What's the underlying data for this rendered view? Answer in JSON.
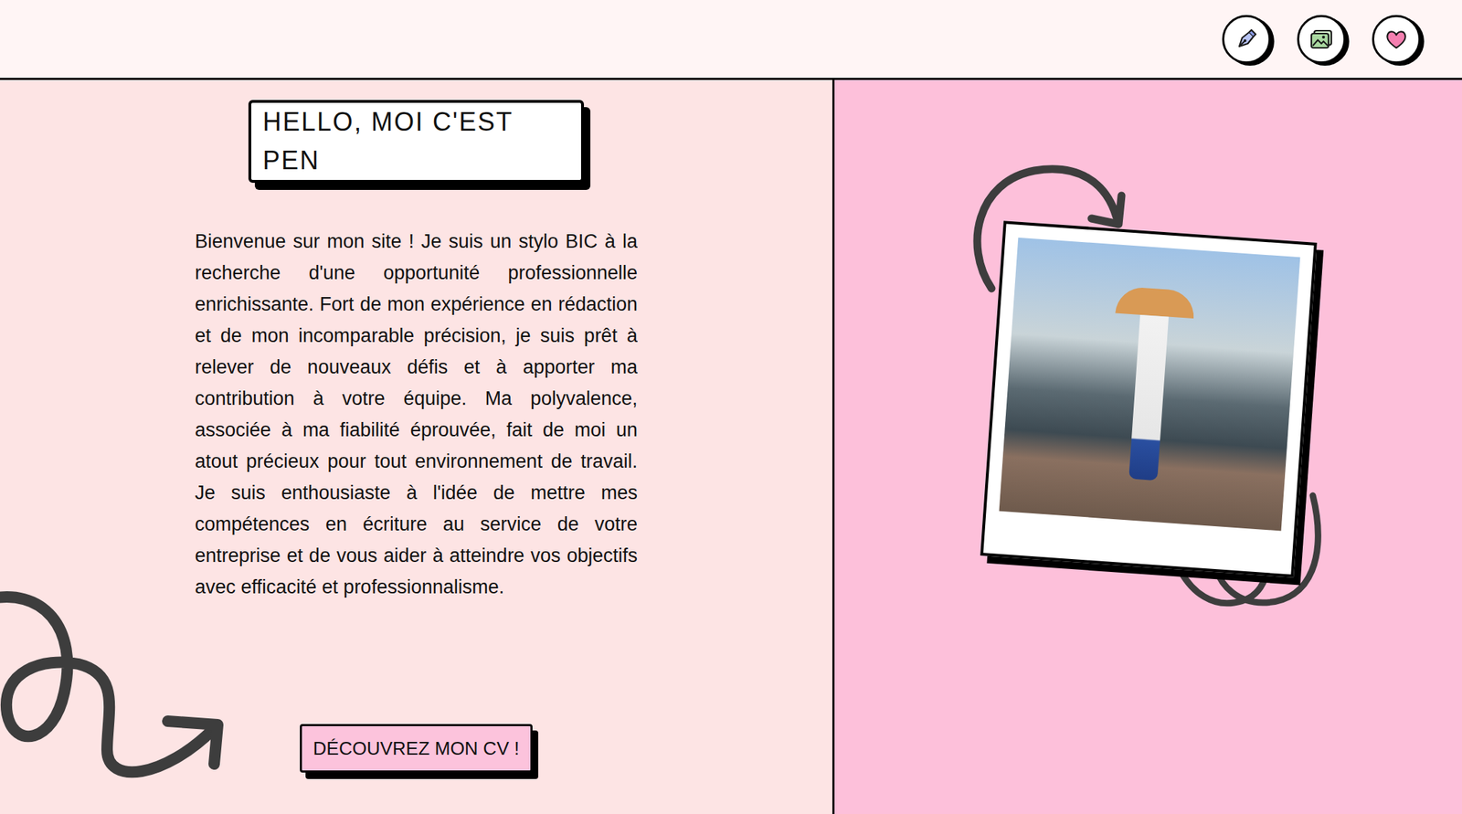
{
  "header": {
    "icons": [
      "pen",
      "gallery",
      "heart"
    ]
  },
  "intro": {
    "title": "HELLO, MOI C'EST PEN",
    "paragraph": "Bienvenue sur mon site ! Je suis un stylo BIC à la recherche d'une opportunité professionnelle enrichissante. Fort de mon expérience en rédaction et de mon incomparable précision, je suis prêt à relever de nouveaux défis et à apporter ma contribution à votre équipe. Ma polyvalence, associée à ma fiabilité éprouvée, fait de moi un atout précieux pour tout environnement de travail. Je suis enthousiaste à l'idée de mettre mes compétences en écriture au service de votre entreprise et de vous aider à atteindre vos objectifs avec efficacité et professionnalisme.",
    "button": "DÉCOUVREZ MON CV !"
  },
  "photo": {
    "kind": "polaroid"
  }
}
